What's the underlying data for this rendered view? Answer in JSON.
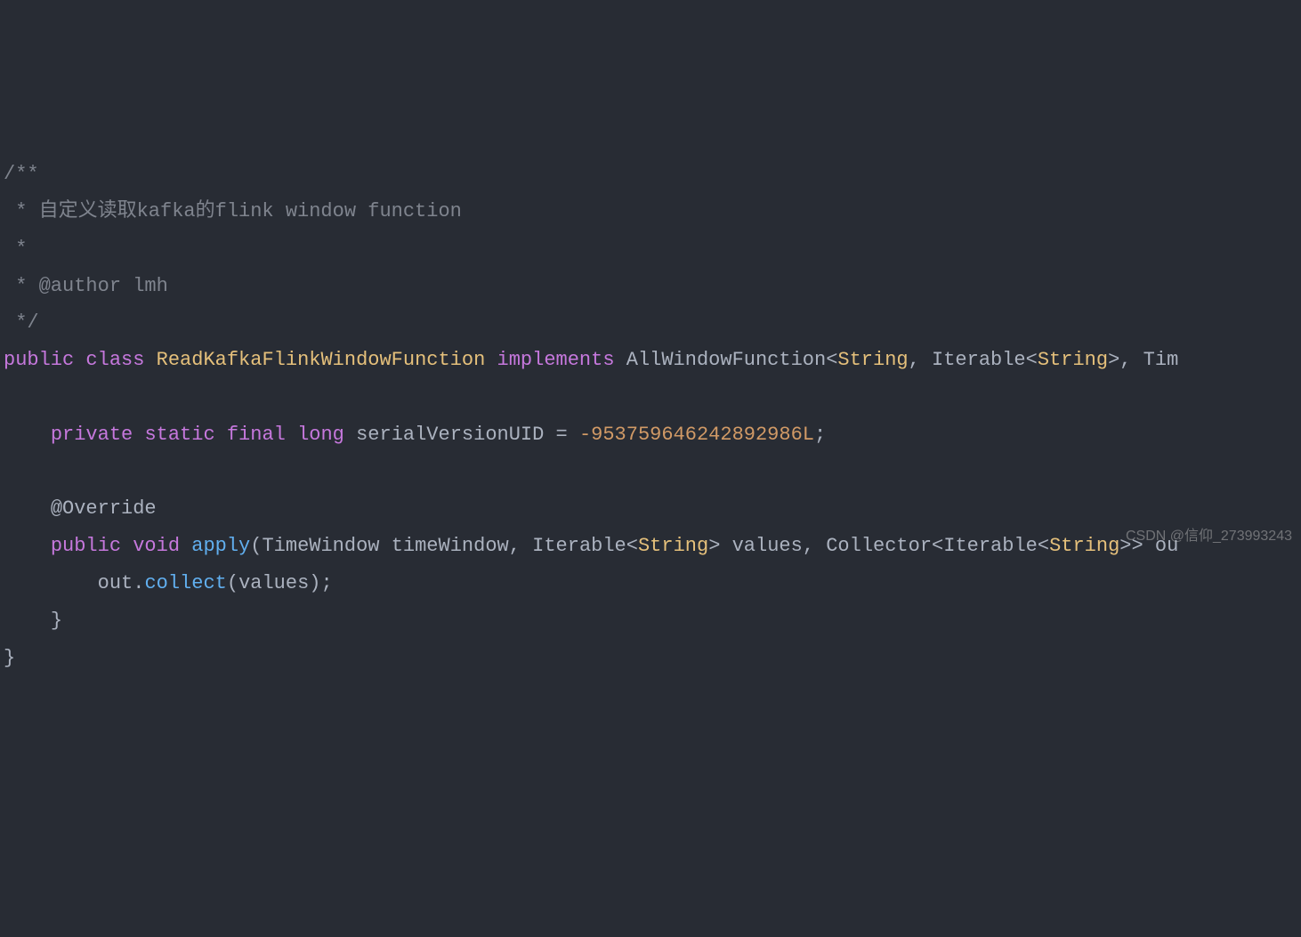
{
  "code": {
    "comment1": "/**",
    "comment2": " * 自定义读取kafka的flink window function",
    "comment3": " *",
    "comment4": " * @author lmh",
    "comment5": " */",
    "kw_public": "public",
    "kw_class": "class",
    "class_name": "ReadKafkaFlinkWindowFunction",
    "kw_implements": "implements",
    "type_allwindow": "AllWindowFunction",
    "type_string": "String",
    "type_iterable": "Iterable",
    "type_time_trunc": "Tim",
    "kw_private": "private",
    "kw_static": "static",
    "kw_final": "final",
    "kw_long": "long",
    "field_serial": "serialVersionUID",
    "eq": "=",
    "serial_value": "-953759646242892986L",
    "semicolon": ";",
    "annotation_override": "@Override",
    "kw_void": "void",
    "method_apply": "apply",
    "type_timewindow": "TimeWindow",
    "param_timewindow": "timeWindow",
    "param_values": "values",
    "type_collector": "Collector",
    "param_out_trunc": "ou",
    "var_out": "out",
    "method_collect": "collect",
    "arg_values": "values",
    "brace_open": "{",
    "brace_close": "}"
  },
  "watermark": "CSDN @信仰_273993243"
}
